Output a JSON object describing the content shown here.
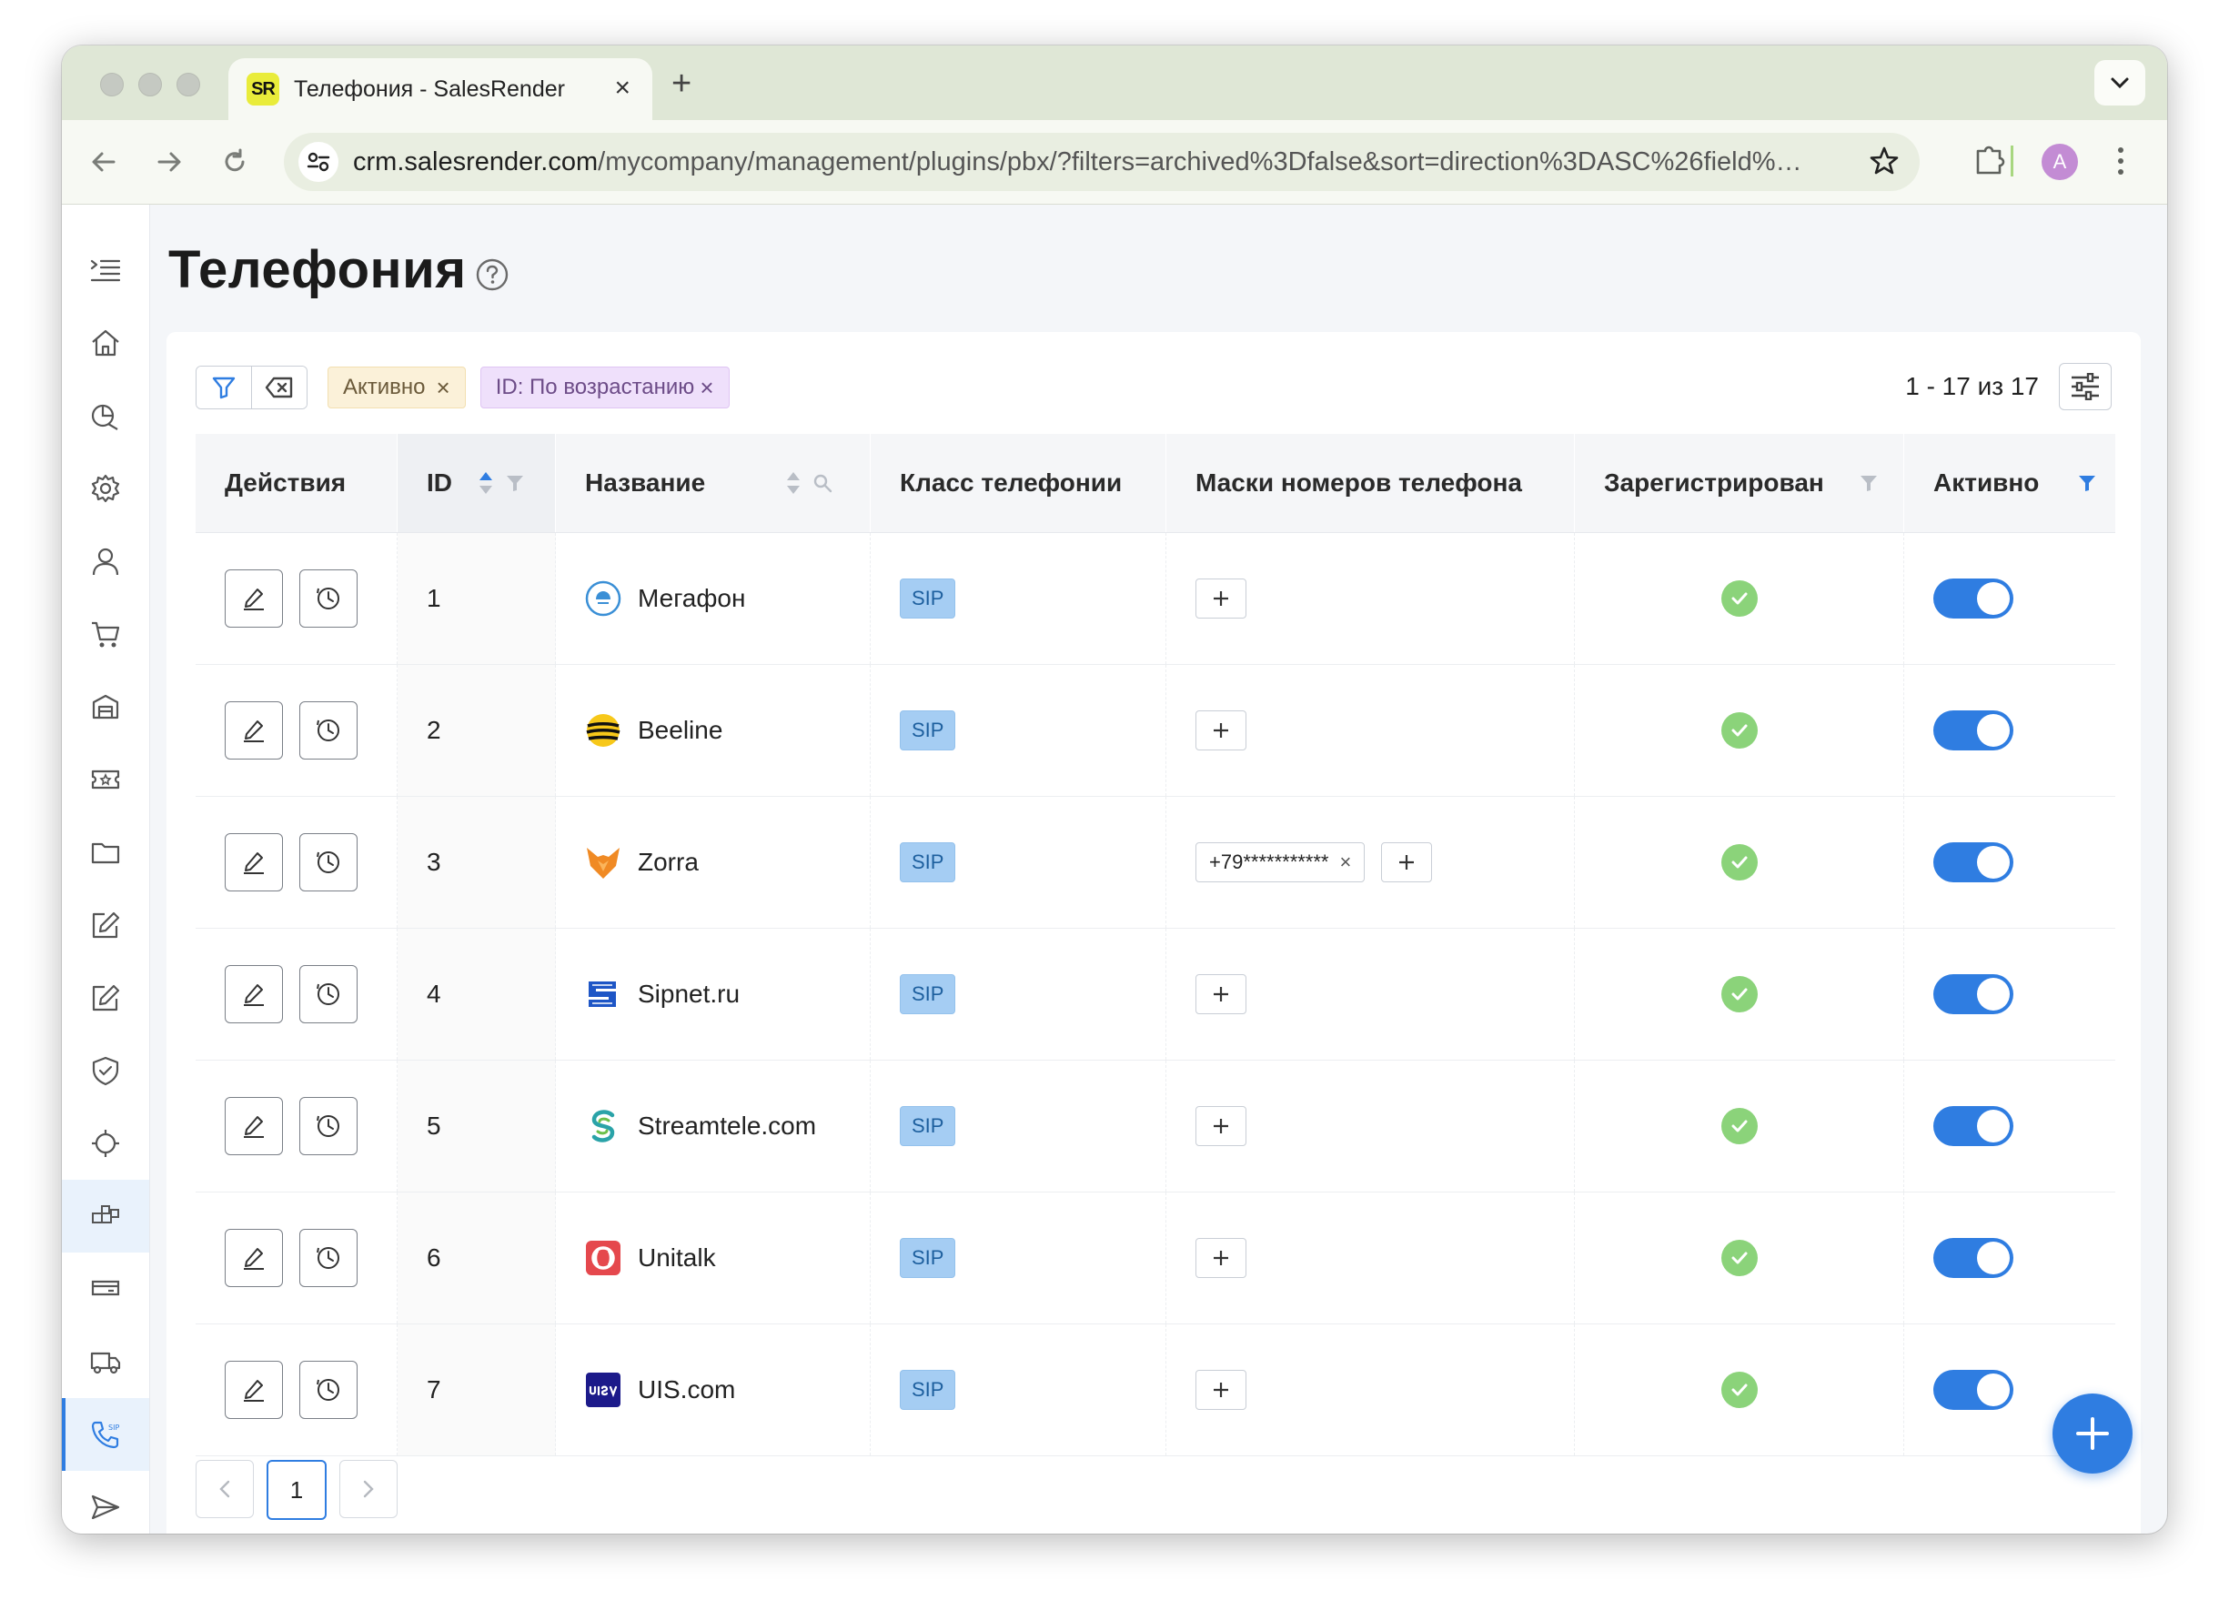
{
  "browser": {
    "tab_title": "Телефония - SalesRender",
    "tab_logo": "SR",
    "url_host": "crm.salesrender.com",
    "url_rest": "/mycompany/management/plugins/pbx/?filters=archived%3Dfalse&sort=direction%3DASC%26field%…",
    "avatar_letter": "A"
  },
  "page": {
    "title": "Телефония"
  },
  "filters": {
    "chips": [
      {
        "label": "Активно"
      },
      {
        "label": "ID: По возрастанию"
      }
    ],
    "pager_info": "1 - 17 из 17"
  },
  "table": {
    "headers": {
      "actions": "Действия",
      "id": "ID",
      "name": "Название",
      "class": "Класс телефонии",
      "masks": "Маски номеров телефона",
      "registered": "Зарегистрирован",
      "active": "Активно"
    },
    "rows": [
      {
        "id": "1",
        "name": "Мегафон",
        "class": "SIP",
        "logo": "megafon-logo-icon",
        "masks": [],
        "registered": true,
        "active": true
      },
      {
        "id": "2",
        "name": "Beeline",
        "class": "SIP",
        "logo": "beeline-logo-icon",
        "masks": [],
        "registered": true,
        "active": true
      },
      {
        "id": "3",
        "name": "Zorra",
        "class": "SIP",
        "logo": "zorra-logo-icon",
        "masks": [
          "+79***********"
        ],
        "registered": true,
        "active": true
      },
      {
        "id": "4",
        "name": "Sipnet.ru",
        "class": "SIP",
        "logo": "sipnet-logo-icon",
        "masks": [],
        "registered": true,
        "active": true
      },
      {
        "id": "5",
        "name": "Streamtele.com",
        "class": "SIP",
        "logo": "streamtele-logo-icon",
        "masks": [],
        "registered": true,
        "active": true
      },
      {
        "id": "6",
        "name": "Unitalk",
        "class": "SIP",
        "logo": "unitalk-logo-icon",
        "masks": [],
        "registered": true,
        "active": true
      },
      {
        "id": "7",
        "name": "UIS.com",
        "class": "SIP",
        "logo": "uis-logo-icon",
        "masks": [],
        "registered": true,
        "active": true
      }
    ]
  },
  "pagination": {
    "current_page": "1"
  },
  "colors": {
    "accent": "#2f7de1",
    "sip_badge": "#a5cdf3",
    "check": "#8bd37a",
    "chip_yellow": "#fbf1d9",
    "chip_purple": "#efe0fb"
  }
}
